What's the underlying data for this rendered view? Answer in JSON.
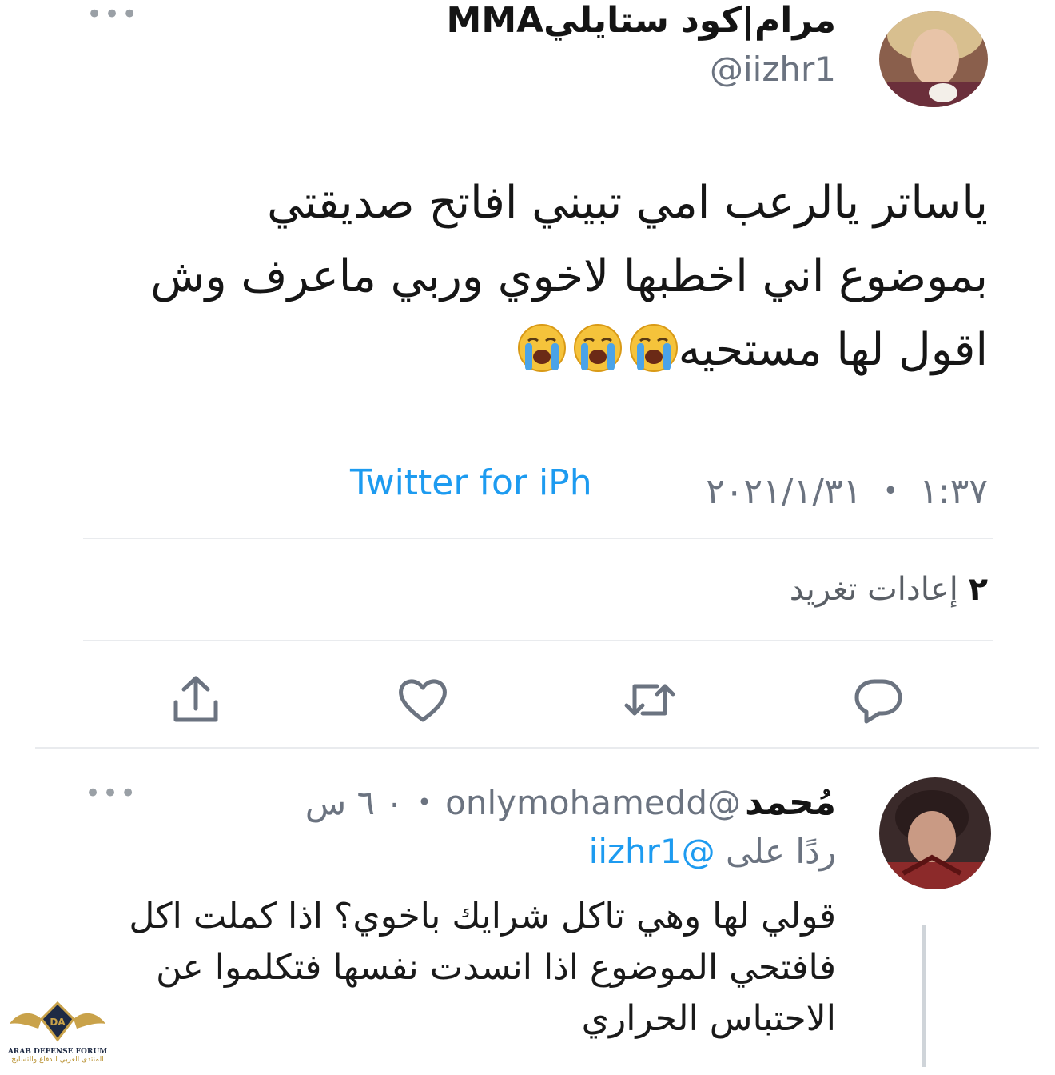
{
  "tweet": {
    "author_name": "مرام|كود ستايليMMA",
    "author_handle": "@iizhr1",
    "text_line1": "ياساتر يالرعب امي تبيني افاتح صديقتي",
    "text_line2": "بموضوع اني اخطبها لاخوي وربي ماعرف وش",
    "text_line3": "اقول لها مستحيه",
    "emoji_count": 3,
    "emoji_name": "loudly-crying-face",
    "timestamp": "١:٣٧ ・ ٢٠٢١/١/٣١",
    "source": "Twitter for iPh",
    "retweets_count": "٢",
    "retweets_label": "إعادات تغريد"
  },
  "actions": {
    "reply_icon": "reply-icon",
    "retweet_icon": "retweet-icon",
    "like_icon": "heart-icon",
    "share_icon": "share-icon"
  },
  "reply": {
    "author_name": "مُحمد",
    "author_handle": "@onlymohamedd",
    "time": "٠ ٦ س",
    "replying_label": "ردًا على",
    "replying_to": "@iizhr1",
    "text_line1": "قولي لها وهي تاكل شرايك باخوي؟ اذا كملت اكل",
    "text_line2": "فافتحي الموضوع اذا انسدت نفسها فتكلموا عن",
    "text_line3": "الاحتباس الحراري"
  },
  "watermark": {
    "logo_text": "DA",
    "line1": "ARAB DEFENSE FORUM",
    "line2": "المنتدى العربي للدفاع والتسليح"
  },
  "colors": {
    "link": "#1d9bf0",
    "muted": "#6b7380",
    "divider": "#e9ebee"
  }
}
